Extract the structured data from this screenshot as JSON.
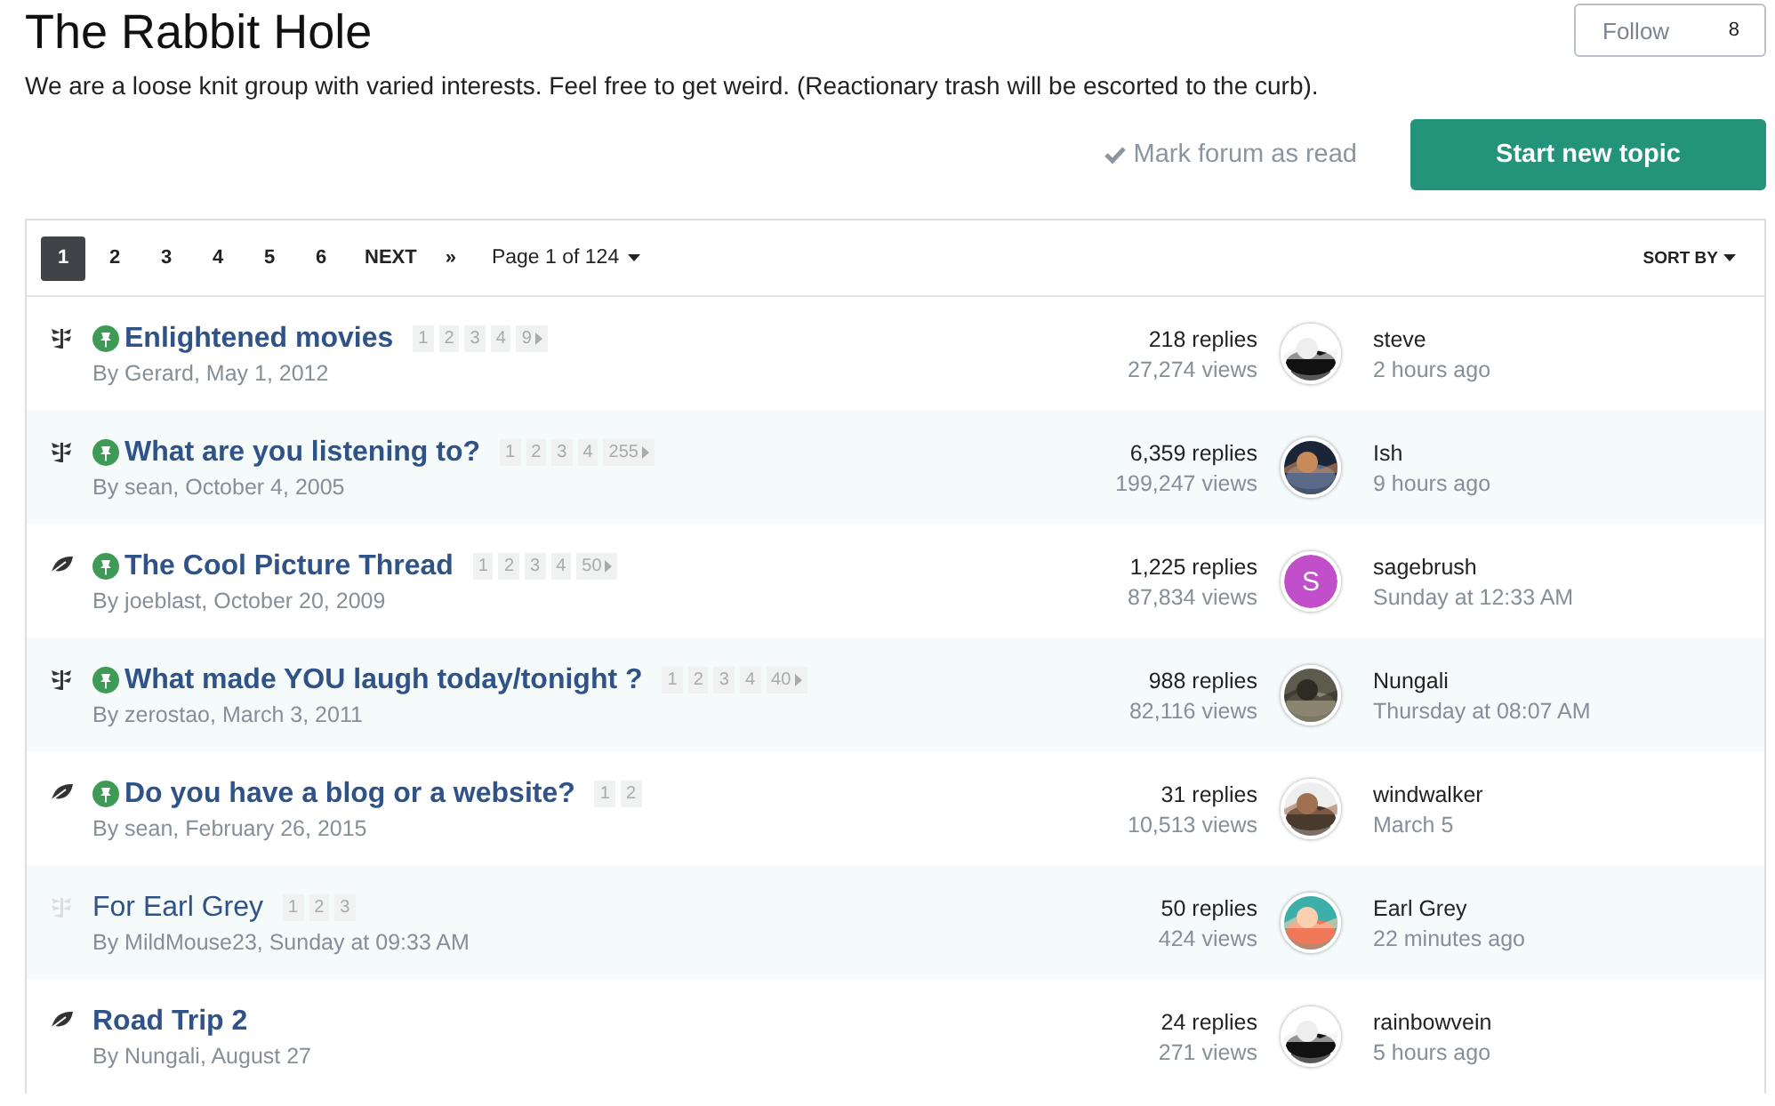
{
  "header": {
    "title": "The Rabbit Hole",
    "description": "We are a loose knit group with varied interests. Feel free to get weird. (Reactionary trash will be escorted to the curb).",
    "follow": {
      "label": "Follow",
      "count": "8"
    }
  },
  "actions": {
    "mark_read": "Mark forum as read",
    "start_topic": "Start new topic"
  },
  "pager": {
    "pages": [
      {
        "label": "1",
        "selected": true
      },
      {
        "label": "2",
        "selected": false
      },
      {
        "label": "3",
        "selected": false
      },
      {
        "label": "4",
        "selected": false
      },
      {
        "label": "5",
        "selected": false
      },
      {
        "label": "6",
        "selected": false
      }
    ],
    "next": "NEXT",
    "last": "»",
    "page_of": "Page 1 of 124",
    "sort": "SORT BY"
  },
  "topics": [
    {
      "kind": "hot",
      "unread": true,
      "pinned": true,
      "title": "Enlightened movies",
      "pages": [
        "1",
        "2",
        "3",
        "4",
        "9"
      ],
      "more": true,
      "byline": "By Gerard, May 1, 2012",
      "replies": "218 replies",
      "views": "27,274 views",
      "avatar": {
        "kind": "picture"
      },
      "last_user": "steve",
      "last_time": "2 hours ago"
    },
    {
      "kind": "hot",
      "unread": true,
      "pinned": true,
      "title": "What are you listening to?",
      "pages": [
        "1",
        "2",
        "3",
        "4",
        "255"
      ],
      "more": true,
      "byline": "By sean, October 4, 2005",
      "replies": "6,359 replies",
      "views": "199,247 views",
      "avatar": {
        "kind": "picture"
      },
      "last_user": "Ish",
      "last_time": "9 hours ago"
    },
    {
      "kind": "leaf",
      "unread": true,
      "pinned": true,
      "title": "The Cool Picture Thread",
      "pages": [
        "1",
        "2",
        "3",
        "4",
        "50"
      ],
      "more": true,
      "byline": "By joeblast, October 20, 2009",
      "replies": "1,225 replies",
      "views": "87,834 views",
      "avatar": {
        "kind": "letter",
        "letter": "S",
        "color": "#c04fc9"
      },
      "last_user": "sagebrush",
      "last_time": "Sunday at 12:33 AM"
    },
    {
      "kind": "hot",
      "unread": true,
      "pinned": true,
      "title": "What made YOU laugh today/tonight ?",
      "pages": [
        "1",
        "2",
        "3",
        "4",
        "40"
      ],
      "more": true,
      "byline": "By zerostao, March 3, 2011",
      "replies": "988 replies",
      "views": "82,116 views",
      "avatar": {
        "kind": "picture"
      },
      "last_user": "Nungali",
      "last_time": "Thursday at 08:07 AM"
    },
    {
      "kind": "leaf",
      "unread": true,
      "pinned": true,
      "title": "Do you have a blog or a website?",
      "pages": [
        "1",
        "2"
      ],
      "more": false,
      "byline": "By sean, February 26, 2015",
      "replies": "31 replies",
      "views": "10,513 views",
      "avatar": {
        "kind": "picture"
      },
      "last_user": "windwalker",
      "last_time": "March 5"
    },
    {
      "kind": "hot",
      "unread": false,
      "pinned": false,
      "title": "For Earl Grey",
      "pages": [
        "1",
        "2",
        "3"
      ],
      "more": false,
      "byline": "By MildMouse23, Sunday at 09:33 AM",
      "replies": "50 replies",
      "views": "424 views",
      "avatar": {
        "kind": "picture"
      },
      "last_user": "Earl Grey",
      "last_time": "22 minutes ago"
    },
    {
      "kind": "leaf",
      "unread": true,
      "pinned": false,
      "title": "Road Trip 2",
      "more": false,
      "byline": "By Nungali, August 27",
      "replies": "24 replies",
      "views": "271 views",
      "avatar": {
        "kind": "picture"
      },
      "last_user": "rainbowvein",
      "last_time": "5 hours ago"
    }
  ]
}
